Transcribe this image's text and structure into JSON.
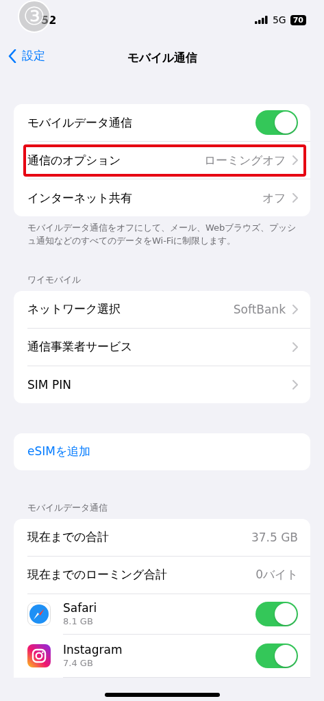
{
  "status_bar": {
    "time": "52",
    "network": "5G",
    "battery": "70"
  },
  "annotation": {
    "badge": "③"
  },
  "nav": {
    "back": "設定",
    "title": "モバイル通信"
  },
  "sections": [
    {
      "rows": [
        {
          "kind": "toggle",
          "label": "モバイルデータ通信",
          "on": true,
          "highlighted": false
        },
        {
          "kind": "detail",
          "label": "通信のオプション",
          "value": "ローミングオフ",
          "highlighted": true
        },
        {
          "kind": "detail",
          "label": "インターネット共有",
          "value": "オフ",
          "highlighted": false
        }
      ],
      "footer": "モバイルデータ通信をオフにして、メール、Webブラウズ、プッシュ通知などのすべてのデータをWi-Fiに制限します。"
    },
    {
      "header": "ワイモバイル",
      "rows": [
        {
          "kind": "detail",
          "label": "ネットワーク選択",
          "value": "SoftBank",
          "highlighted": false
        },
        {
          "kind": "detail",
          "label": "通信事業者サービス",
          "highlighted": false
        },
        {
          "kind": "detail",
          "label": "SIM PIN",
          "highlighted": false
        }
      ]
    },
    {
      "rows": [
        {
          "kind": "link",
          "label": "eSIMを追加",
          "highlighted": false
        }
      ]
    },
    {
      "header": "モバイルデータ通信",
      "rows": [
        {
          "kind": "stat",
          "label": "現在までの合計",
          "value": "37.5 GB",
          "highlighted": false
        },
        {
          "kind": "stat",
          "label": "現在までのローミング合計",
          "value": "0バイト",
          "highlighted": false
        },
        {
          "kind": "safari",
          "label": "Safari",
          "sub": "8.1 GB",
          "on": true,
          "highlighted": false
        },
        {
          "kind": "instagram",
          "label": "Instagram",
          "sub": "7.4 GB",
          "on": true,
          "highlighted": false
        }
      ]
    }
  ]
}
